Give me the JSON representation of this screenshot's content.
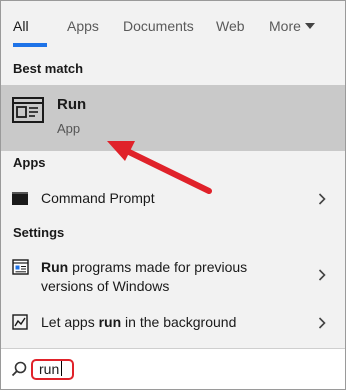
{
  "tabs": [
    {
      "label": "All"
    },
    {
      "label": "Apps"
    },
    {
      "label": "Documents"
    },
    {
      "label": "Web"
    },
    {
      "label": "More"
    }
  ],
  "best_match": {
    "header": "Best match",
    "title": "Run",
    "subtitle": "App"
  },
  "apps": {
    "header": "Apps",
    "items": [
      {
        "label": "Command Prompt"
      }
    ]
  },
  "settings": {
    "header": "Settings",
    "items": [
      {
        "bold": "Run",
        "rest": " programs made for previous",
        "line2": "versions of Windows"
      },
      {
        "pre": "Let apps ",
        "bold": "run",
        "post": " in the background"
      }
    ]
  },
  "search": {
    "value": "run"
  },
  "colors": {
    "accent": "#1e73e8",
    "annotation": "#e0222a",
    "selected_row": "#c9c9c9"
  }
}
